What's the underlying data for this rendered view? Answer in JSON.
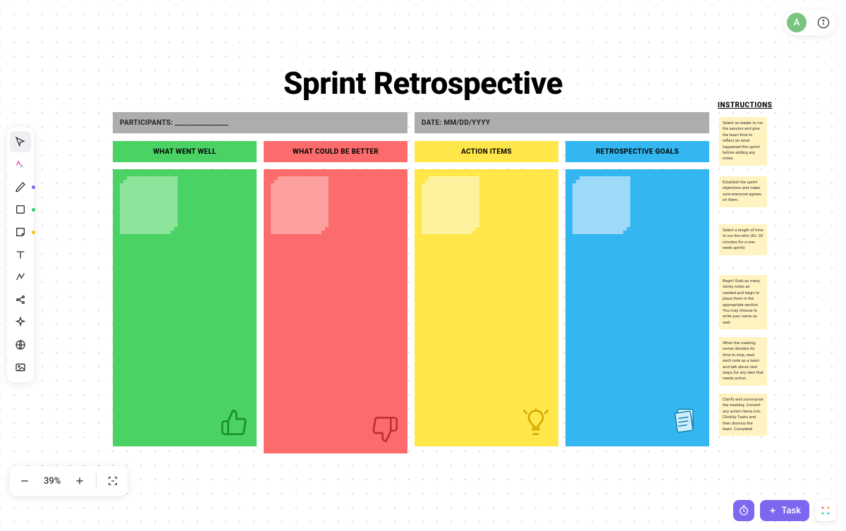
{
  "title": "Sprint Retrospective",
  "participants_label": "PARTICIPANTS: ________________",
  "date_label": "DATE: MM/DD/YYYY",
  "columns": {
    "well": "WHAT WENT WELL",
    "better": "WHAT COULD BE BETTER",
    "actions": "ACTION ITEMS",
    "goals": "RETROSPECTIVE GOALS"
  },
  "instructions_title": "INSTRUCTIONS",
  "instructions": [
    "Select an leader to run the session and give the team time to reflect on what happened this sprint before adding any notes.",
    "Establish the sprint objectives and make sure everyone agrees on them.",
    "Select a length of time to run the retro (Ex: 30 minutes for a one-week sprint)",
    "Begin! Grab as many sticky notes as needed and begin to place them in the appropriate section. You may choose to write your name as well.",
    "When the meeting owner decides its time to stop, read each note as a team and talk about next steps for any item that needs action.",
    "Clarify and summarize the meeting. Convert any action items into ClickUp Tasks and then dismiss the team. Complete!"
  ],
  "avatar_letter": "A",
  "zoom": "39%",
  "task_button": "Task"
}
